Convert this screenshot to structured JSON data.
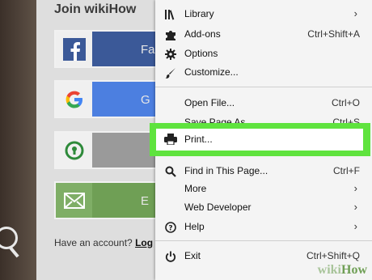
{
  "page": {
    "heading": "Join wikiHow",
    "buttons": [
      {
        "service": "facebook",
        "label": "Fa"
      },
      {
        "service": "google",
        "label": "G"
      },
      {
        "service": "other",
        "label": ""
      },
      {
        "service": "email",
        "label": "E"
      }
    ],
    "have_account_text": "Have an account? ",
    "login_link": "Log"
  },
  "menu": {
    "items": [
      {
        "icon": "library-icon",
        "label": "Library",
        "shortcut": "",
        "submenu": true
      },
      {
        "icon": "puzzle-icon",
        "label": "Add-ons",
        "shortcut": "Ctrl+Shift+A",
        "submenu": false
      },
      {
        "icon": "gear-icon",
        "label": "Options",
        "shortcut": "",
        "submenu": false
      },
      {
        "icon": "paintbrush-icon",
        "label": "Customize...",
        "shortcut": "",
        "submenu": false
      },
      {
        "icon": "",
        "label": "Open File...",
        "shortcut": "Ctrl+O",
        "submenu": false
      },
      {
        "icon": "",
        "label": "Save Page As...",
        "shortcut": "Ctrl+S",
        "submenu": false
      },
      {
        "icon": "printer-icon",
        "label": "Print...",
        "shortcut": "",
        "submenu": false
      },
      {
        "icon": "search-icon",
        "label": "Find in This Page...",
        "shortcut": "Ctrl+F",
        "submenu": false
      },
      {
        "icon": "",
        "label": "More",
        "shortcut": "",
        "submenu": true
      },
      {
        "icon": "",
        "label": "Web Developer",
        "shortcut": "",
        "submenu": true
      },
      {
        "icon": "help-icon",
        "label": "Help",
        "shortcut": "",
        "submenu": true
      },
      {
        "icon": "power-icon",
        "label": "Exit",
        "shortcut": "Ctrl+Shift+Q",
        "submenu": false
      }
    ]
  },
  "highlight_color": "#5fe33e",
  "watermark": {
    "prefix": "wiki",
    "suffix": "How"
  }
}
